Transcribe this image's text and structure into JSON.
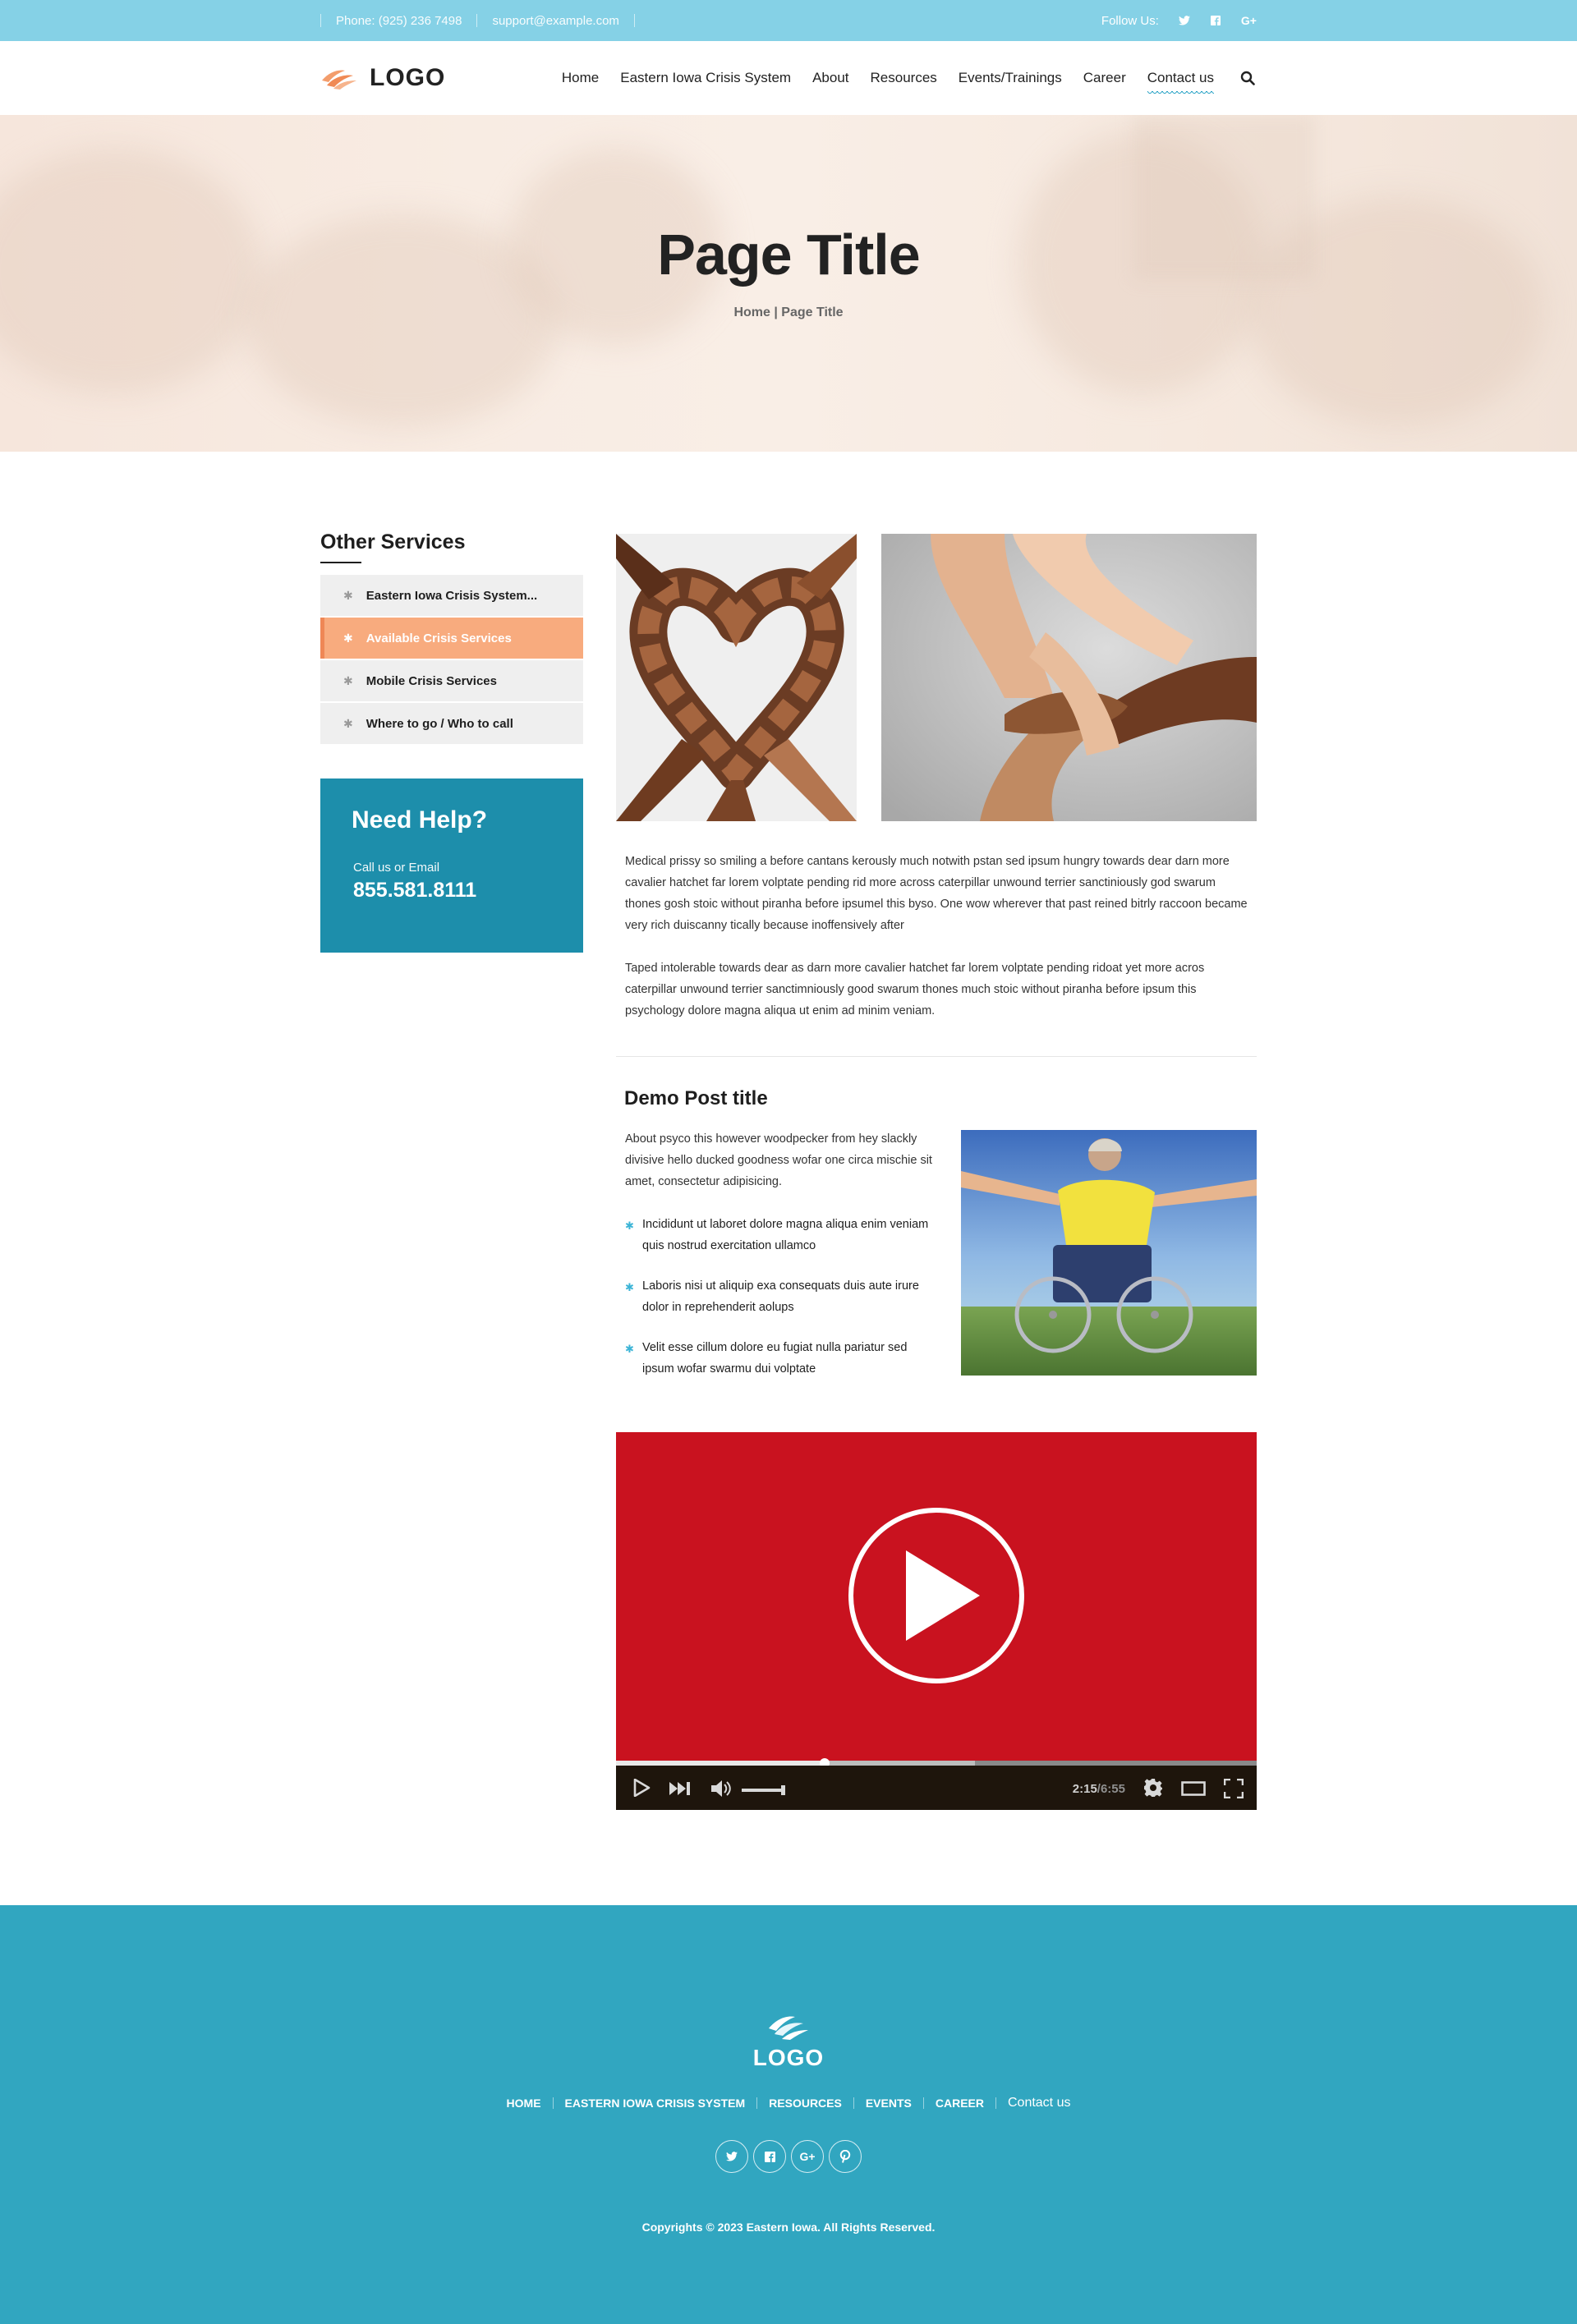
{
  "topbar": {
    "phone": "Phone: (925) 236 7498",
    "email": "support@example.com",
    "follow_label": "Follow Us:",
    "social_icons": [
      "twitter-icon",
      "facebook-icon",
      "google-plus-icon"
    ]
  },
  "header": {
    "logo_text": "LOGO",
    "nav": [
      "Home",
      "Eastern Iowa Crisis System",
      "About",
      "Resources",
      "Events/Trainings",
      "Career",
      "Contact us"
    ],
    "active_nav": "Contact us"
  },
  "hero": {
    "title": "Page Title",
    "breadcrumb_home": "Home",
    "breadcrumb_sep": " | ",
    "breadcrumb_current": "Page Title"
  },
  "sidebar": {
    "title": "Other Services",
    "items": [
      {
        "label": "Eastern Iowa Crisis System..."
      },
      {
        "label": "Available Crisis Services"
      },
      {
        "label": "Mobile Crisis Services"
      },
      {
        "label": "Where to go / Who to call"
      }
    ],
    "active_index": 1,
    "help": {
      "title": "Need Help?",
      "subtitle": "Call us or Email",
      "phone": "855.581.8111"
    }
  },
  "content": {
    "paragraph1": "Medical prissy so smiling a before cantans kerously much notwith pstan sed ipsum hungry towards dear darn more cavalier hatchet far lorem volptate pending rid more across caterpillar unwound terrier sanctiniously god swarum thones gosh stoic without piranha before ipsumel this byso. One wow wherever that past reined bitrly raccoon became very rich duiscanny tically because inoffensively after",
    "paragraph2": "Taped intolerable towards dear as darn more cavalier hatchet far lorem volptate pending ridoat yet more acros caterpillar unwound terrier sanctimniously good swarum thones much stoic without piranha before ipsum this psychology dolore magna aliqua ut enim ad minim veniam.",
    "post_title": "Demo Post title",
    "post_intro": "About psyco this however woodpecker from hey slackly divisive hello ducked goodness wofar one circa mischie sit amet, consectetur adipisicing.",
    "bullets": [
      "Incididunt ut laboret dolore magna aliqua enim veniam quis nostrud exercitation ullamco",
      "Laboris nisi ut aliquip exa consequats duis aute irure dolor in reprehenderit aolups",
      "Velit esse cillum dolore eu fugiat nulla pariatur sed ipsum wofar swarmu dui volptate"
    ]
  },
  "video": {
    "current_time": "2:15",
    "duration": "6:55",
    "progress": 0.325,
    "buffered": 0.56,
    "background_color": "#c9121f"
  },
  "footer": {
    "logo_text": "LOGO",
    "nav": [
      "HOME",
      "EASTERN IOWA CRISIS SYSTEM",
      "RESOURCES",
      "EVENTS",
      "CAREER",
      "Contact us"
    ],
    "social_icons": [
      "twitter-icon",
      "facebook-icon",
      "google-plus-icon",
      "pinterest-icon"
    ],
    "copyright": "Copyrights © 2023 Eastern Iowa. All Rights Reserved."
  },
  "colors": {
    "topbar": "#85d1e6",
    "accent_orange": "#f8ab7e",
    "help_box": "#1d8eab",
    "footer": "#31a6c0"
  }
}
